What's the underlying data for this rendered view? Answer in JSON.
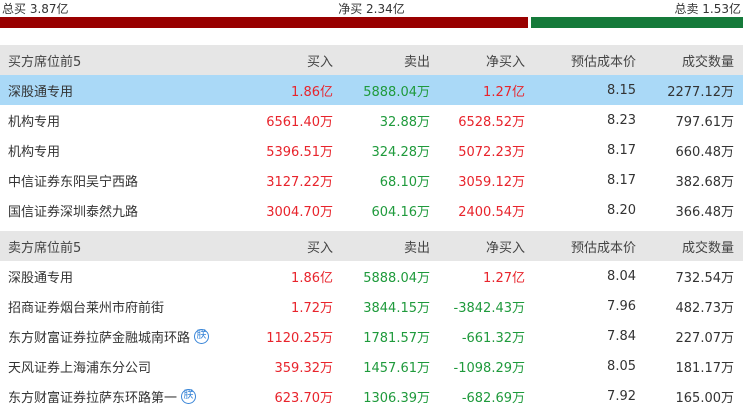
{
  "summary": {
    "total_buy": "总买 3.87亿",
    "net_buy": "净买 2.34亿",
    "total_sell": "总卖 1.53亿"
  },
  "buy_section": {
    "headers": [
      "买方席位前5",
      "买入",
      "卖出",
      "净买入",
      "预估成本价",
      "成交数量"
    ],
    "rows": [
      {
        "name": "深股通专用",
        "buy": "1.86亿",
        "sell": "5888.04万",
        "net": "1.27亿",
        "cost": "8.15",
        "volume": "2277.12万",
        "badge": ""
      },
      {
        "name": "机构专用",
        "buy": "6561.40万",
        "sell": "32.88万",
        "net": "6528.52万",
        "cost": "8.23",
        "volume": "797.61万",
        "badge": ""
      },
      {
        "name": "机构专用",
        "buy": "5396.51万",
        "sell": "324.28万",
        "net": "5072.23万",
        "cost": "8.17",
        "volume": "660.48万",
        "badge": ""
      },
      {
        "name": "中信证券东阳吴宁西路",
        "buy": "3127.22万",
        "sell": "68.10万",
        "net": "3059.12万",
        "cost": "8.17",
        "volume": "382.68万",
        "badge": ""
      },
      {
        "name": "国信证券深圳泰然九路",
        "buy": "3004.70万",
        "sell": "604.16万",
        "net": "2400.54万",
        "cost": "8.20",
        "volume": "366.48万",
        "badge": ""
      }
    ]
  },
  "sell_section": {
    "headers": [
      "卖方席位前5",
      "买入",
      "卖出",
      "净买入",
      "预估成本价",
      "成交数量"
    ],
    "rows": [
      {
        "name": "深股通专用",
        "buy": "1.86亿",
        "sell": "5888.04万",
        "net": "1.27亿",
        "cost": "8.04",
        "volume": "732.54万",
        "badge": ""
      },
      {
        "name": "招商证券烟台莱州市府前街",
        "buy": "1.72万",
        "sell": "3844.15万",
        "net": "-3842.43万",
        "cost": "7.96",
        "volume": "482.73万",
        "badge": ""
      },
      {
        "name": "东方财富证券拉萨金融城南环路",
        "buy": "1120.25万",
        "sell": "1781.57万",
        "net": "-661.32万",
        "cost": "7.84",
        "volume": "227.07万",
        "badge": "朕"
      },
      {
        "name": "天风证券上海浦东分公司",
        "buy": "359.32万",
        "sell": "1457.61万",
        "net": "-1098.29万",
        "cost": "8.05",
        "volume": "181.17万",
        "badge": ""
      },
      {
        "name": "东方财富证券拉萨东环路第一",
        "buy": "623.70万",
        "sell": "1306.39万",
        "net": "-682.69万",
        "cost": "7.92",
        "volume": "165.00万",
        "badge": "朕"
      }
    ]
  },
  "colors": {
    "buy_bar": "#990000",
    "sell_bar": "#157a3a",
    "header_bg": "#e6e6e6",
    "highlight_bg": "#aad9f7",
    "up": "#e8242c",
    "down": "#1f9a3c"
  }
}
